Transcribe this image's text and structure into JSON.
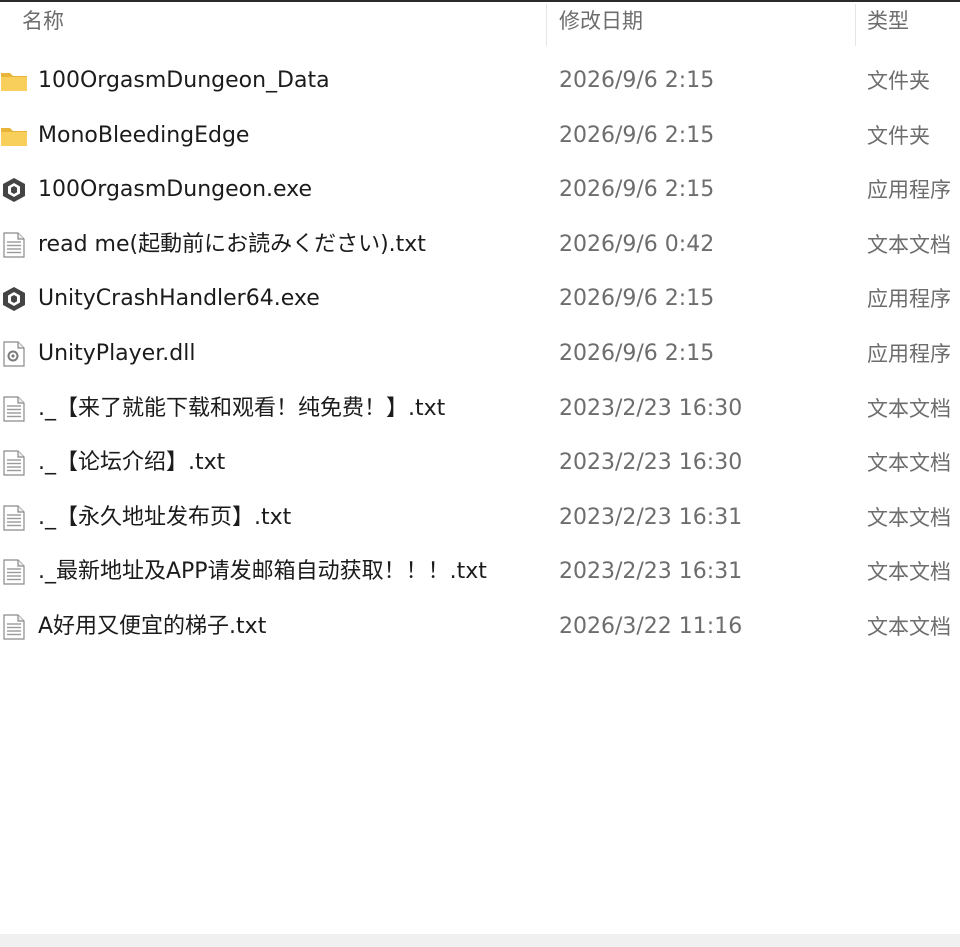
{
  "columns": {
    "name": "名称",
    "date": "修改日期",
    "type": "类型"
  },
  "files": [
    {
      "name": "100OrgasmDungeon_Data",
      "date": "2026/9/6 2:15",
      "type": "文件夹",
      "icon": "folder-icon"
    },
    {
      "name": "MonoBleedingEdge",
      "date": "2026/9/6 2:15",
      "type": "文件夹",
      "icon": "folder-icon"
    },
    {
      "name": "100OrgasmDungeon.exe",
      "date": "2026/9/6 2:15",
      "type": "应用程序",
      "icon": "unity-app-icon"
    },
    {
      "name": "read me(起動前にお読みください).txt",
      "date": "2026/9/6 0:42",
      "type": "文本文档",
      "icon": "text-file-icon"
    },
    {
      "name": "UnityCrashHandler64.exe",
      "date": "2026/9/6 2:15",
      "type": "应用程序",
      "icon": "unity-app-icon"
    },
    {
      "name": "UnityPlayer.dll",
      "date": "2026/9/6 2:15",
      "type": "应用程序",
      "icon": "dll-file-icon"
    },
    {
      "name": "._【来了就能下载和观看！纯免费！】.txt",
      "date": "2023/2/23 16:30",
      "type": "文本文档",
      "icon": "text-file-icon"
    },
    {
      "name": "._【论坛介绍】.txt",
      "date": "2023/2/23 16:30",
      "type": "文本文档",
      "icon": "text-file-icon"
    },
    {
      "name": "._【永久地址发布页】.txt",
      "date": "2023/2/23 16:31",
      "type": "文本文档",
      "icon": "text-file-icon"
    },
    {
      "name": "._最新地址及APP请发邮箱自动获取！！！.txt",
      "date": "2023/2/23 16:31",
      "type": "文本文档",
      "icon": "text-file-icon"
    },
    {
      "name": "A好用又便宜的梯子.txt",
      "date": "2026/3/22 11:16",
      "type": "文本文档",
      "icon": "text-file-icon"
    }
  ]
}
